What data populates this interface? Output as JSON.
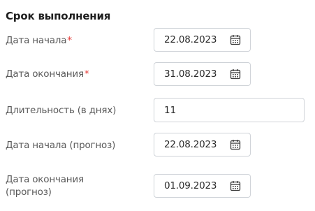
{
  "section": {
    "title": "Срок выполнения"
  },
  "fields": [
    {
      "label": "Дата начала",
      "required": true,
      "value": "22.08.2023",
      "icon": "calendar-icon"
    },
    {
      "label": "Дата окончания",
      "required": true,
      "value": "31.08.2023",
      "icon": "calendar-icon"
    },
    {
      "label": "Длительность (в днях)",
      "required": false,
      "value": "11"
    },
    {
      "label": "Дата начала (прогноз)",
      "required": false,
      "value": "22.08.2023",
      "icon": "calendar-icon"
    },
    {
      "label_line1": "Дата окончания",
      "label_line2": "(прогноз)",
      "required": false,
      "value": "01.09.2023",
      "icon": "calendar-icon"
    }
  ],
  "required_mark": "*",
  "colors": {
    "required": "#e53935",
    "border": "#cfd3d8",
    "label": "#5a5a5a"
  }
}
